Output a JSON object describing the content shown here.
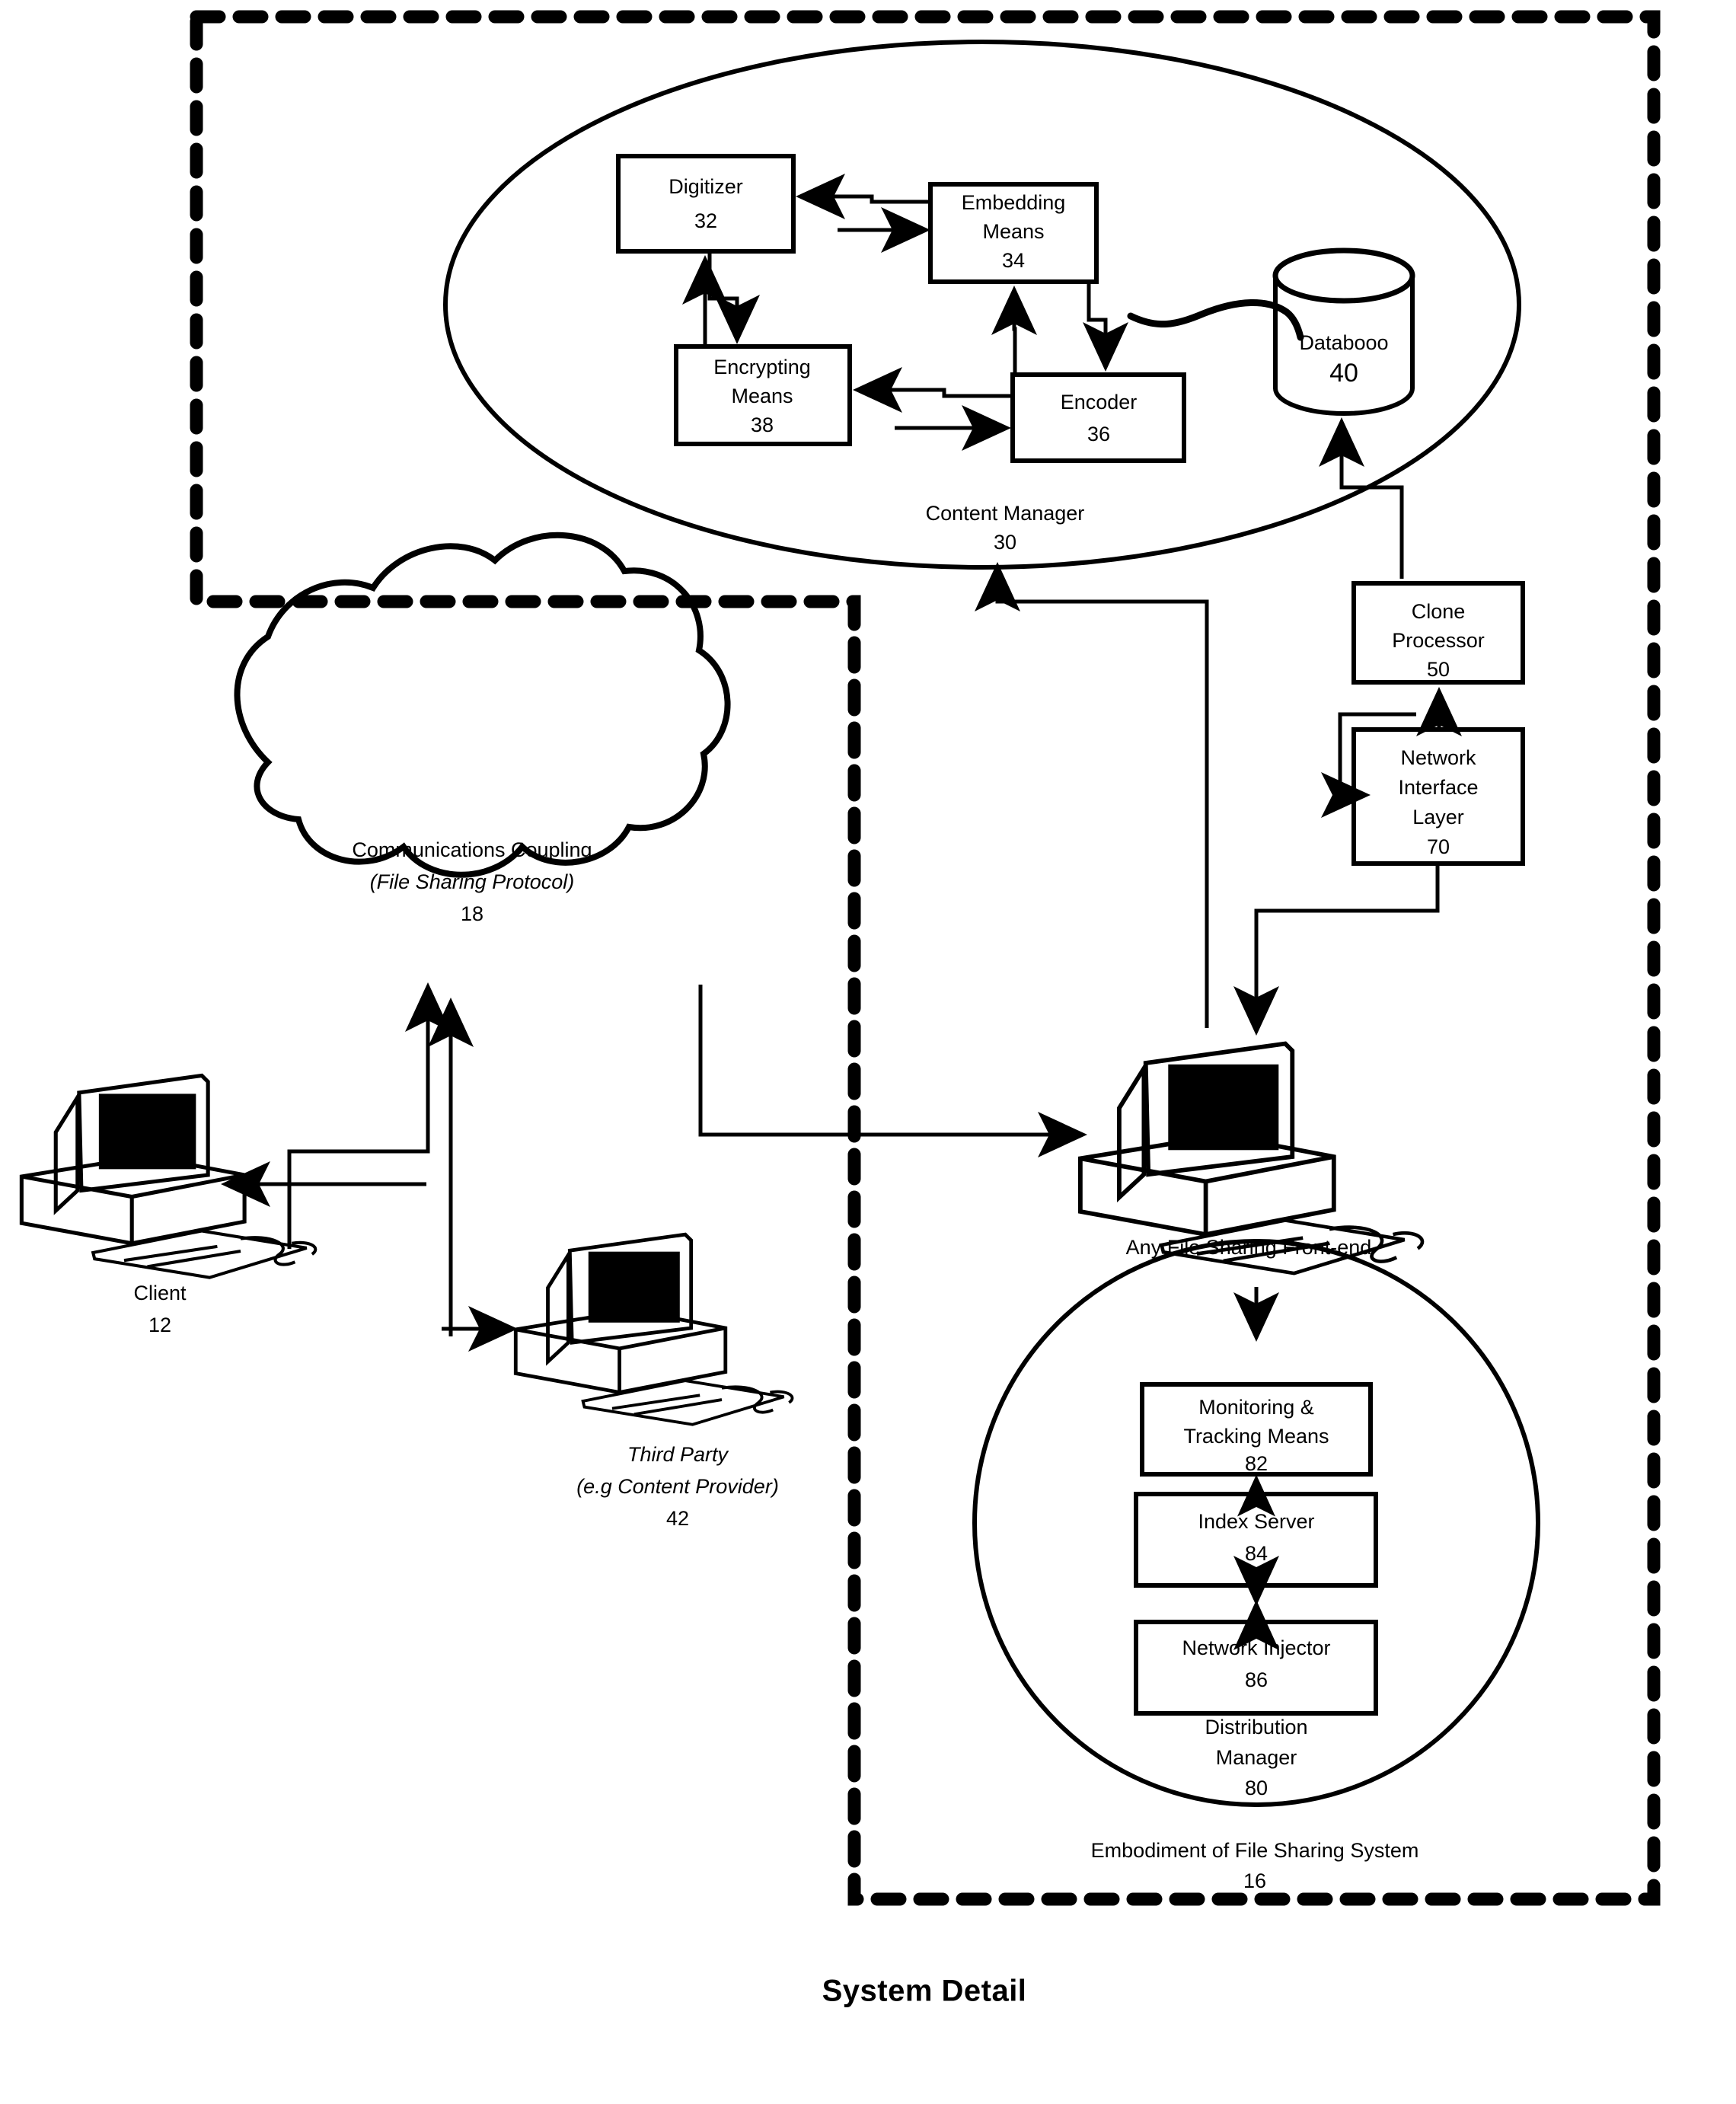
{
  "figure": {
    "title": "System Detail",
    "outer_boundary_style": "thick-dashed"
  },
  "content_manager": {
    "label": "Content Manager",
    "ref": "30",
    "boxes": [
      {
        "name": "digitizer",
        "lines": [
          "Digitizer"
        ],
        "ref": "32"
      },
      {
        "name": "embedding-means",
        "lines": [
          "Embedding",
          "Means"
        ],
        "ref": "34"
      },
      {
        "name": "encrypting-means",
        "lines": [
          "Encrypting",
          "Means"
        ],
        "ref": "38"
      },
      {
        "name": "encoder",
        "lines": [
          "Encoder"
        ],
        "ref": "36"
      }
    ],
    "database": {
      "label": "Databooo",
      "ref": "40"
    }
  },
  "right_stack": {
    "clone_processor": {
      "lines": [
        "Clone",
        "Processor"
      ],
      "ref": "50"
    },
    "network_interface_layer": {
      "lines": [
        "Network",
        "Interface",
        "Layer"
      ],
      "ref": "70"
    }
  },
  "cloud": {
    "line1": "Communications Coupling",
    "line2": "(File Sharing Protocol)",
    "ref": "18"
  },
  "client": {
    "label": "Client",
    "ref": "12"
  },
  "third_party": {
    "line1": "Third Party",
    "line2": "(e.g  Content Provider)",
    "ref": "42"
  },
  "front_end": {
    "label": "Any File Sharing Front-end"
  },
  "distribution_manager": {
    "label_line1": "Distribution",
    "label_line2": "Manager",
    "ref": "80",
    "boxes": [
      {
        "name": "monitoring-tracking-means",
        "lines": [
          "Monitoring &",
          "Tracking Means"
        ],
        "ref": "82"
      },
      {
        "name": "index-server",
        "lines": [
          "Index Server"
        ],
        "ref": "84"
      },
      {
        "name": "network-injector",
        "lines": [
          "Network Injector"
        ],
        "ref": "86"
      }
    ]
  },
  "file_sharing_system": {
    "label": "Embodiment of File Sharing System",
    "ref": "16"
  },
  "colors": {
    "ink": "#000000",
    "paper": "#ffffff"
  }
}
